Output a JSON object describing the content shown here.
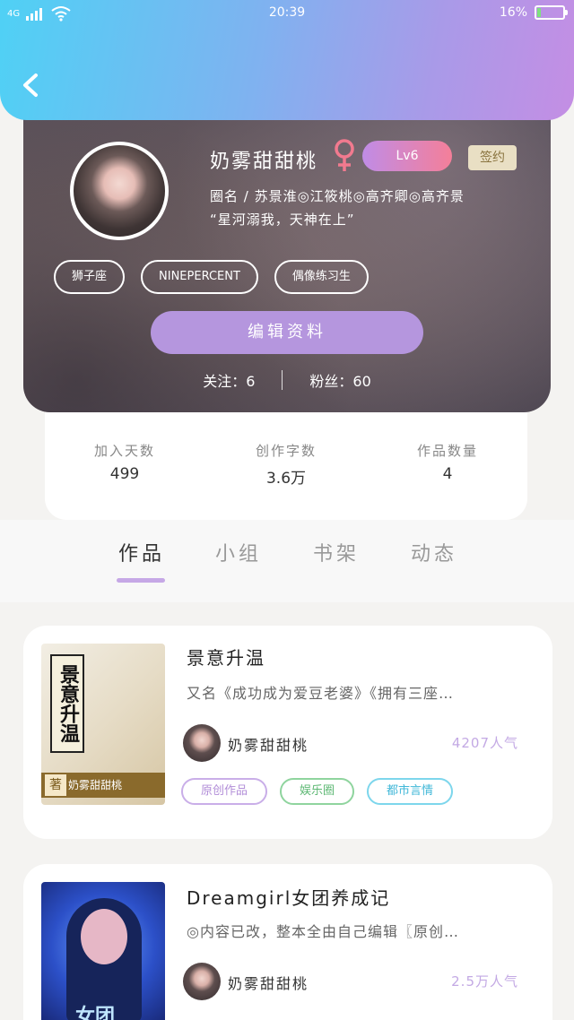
{
  "status_bar": {
    "network": "4G",
    "time": "20:39",
    "battery": "16%",
    "battery_level": 0.16
  },
  "profile": {
    "name": "奶雾甜甜桃",
    "gender_symbol": "♀",
    "level": "Lv6",
    "signed_badge": "签约",
    "bio_line1": "圈名 / 苏景淮◎江筱桃◎高齐卿◎高齐景",
    "bio_line2": "“星河溺我，天神在上”",
    "tags": [
      "狮子座",
      "NINEPERCENT",
      "偶像练习生"
    ],
    "edit_button": "编辑资料",
    "following_label": "关注：",
    "following_count": "6",
    "fans_label": "粉丝：",
    "fans_count": "60"
  },
  "stats": [
    {
      "label": "加入天数",
      "value": "499"
    },
    {
      "label": "创作字数",
      "value": "3.6万"
    },
    {
      "label": "作品数量",
      "value": "4"
    }
  ],
  "tabs": [
    {
      "label": "作品",
      "active": true
    },
    {
      "label": "小组",
      "active": false
    },
    {
      "label": "书架",
      "active": false
    },
    {
      "label": "动态",
      "active": false
    }
  ],
  "works": [
    {
      "title": "景意升温",
      "description": "又名《成功成为爱豆老婆》《拥有三座…",
      "author": "奶雾甜甜桃",
      "popularity": "4207人气",
      "cover_title": "景意升温",
      "cover_mark": "著",
      "cover_author": "奶雾甜甜桃",
      "tags": [
        "原创作品",
        "娱乐圈",
        "都市言情"
      ]
    },
    {
      "title": "Dreamgirl女团养成记",
      "description": "◎内容已改，整本全由自己编辑〖原创…",
      "author": "奶雾甜甜桃",
      "popularity": "2.5万人气",
      "cover_title": "女团",
      "tags": []
    }
  ]
}
